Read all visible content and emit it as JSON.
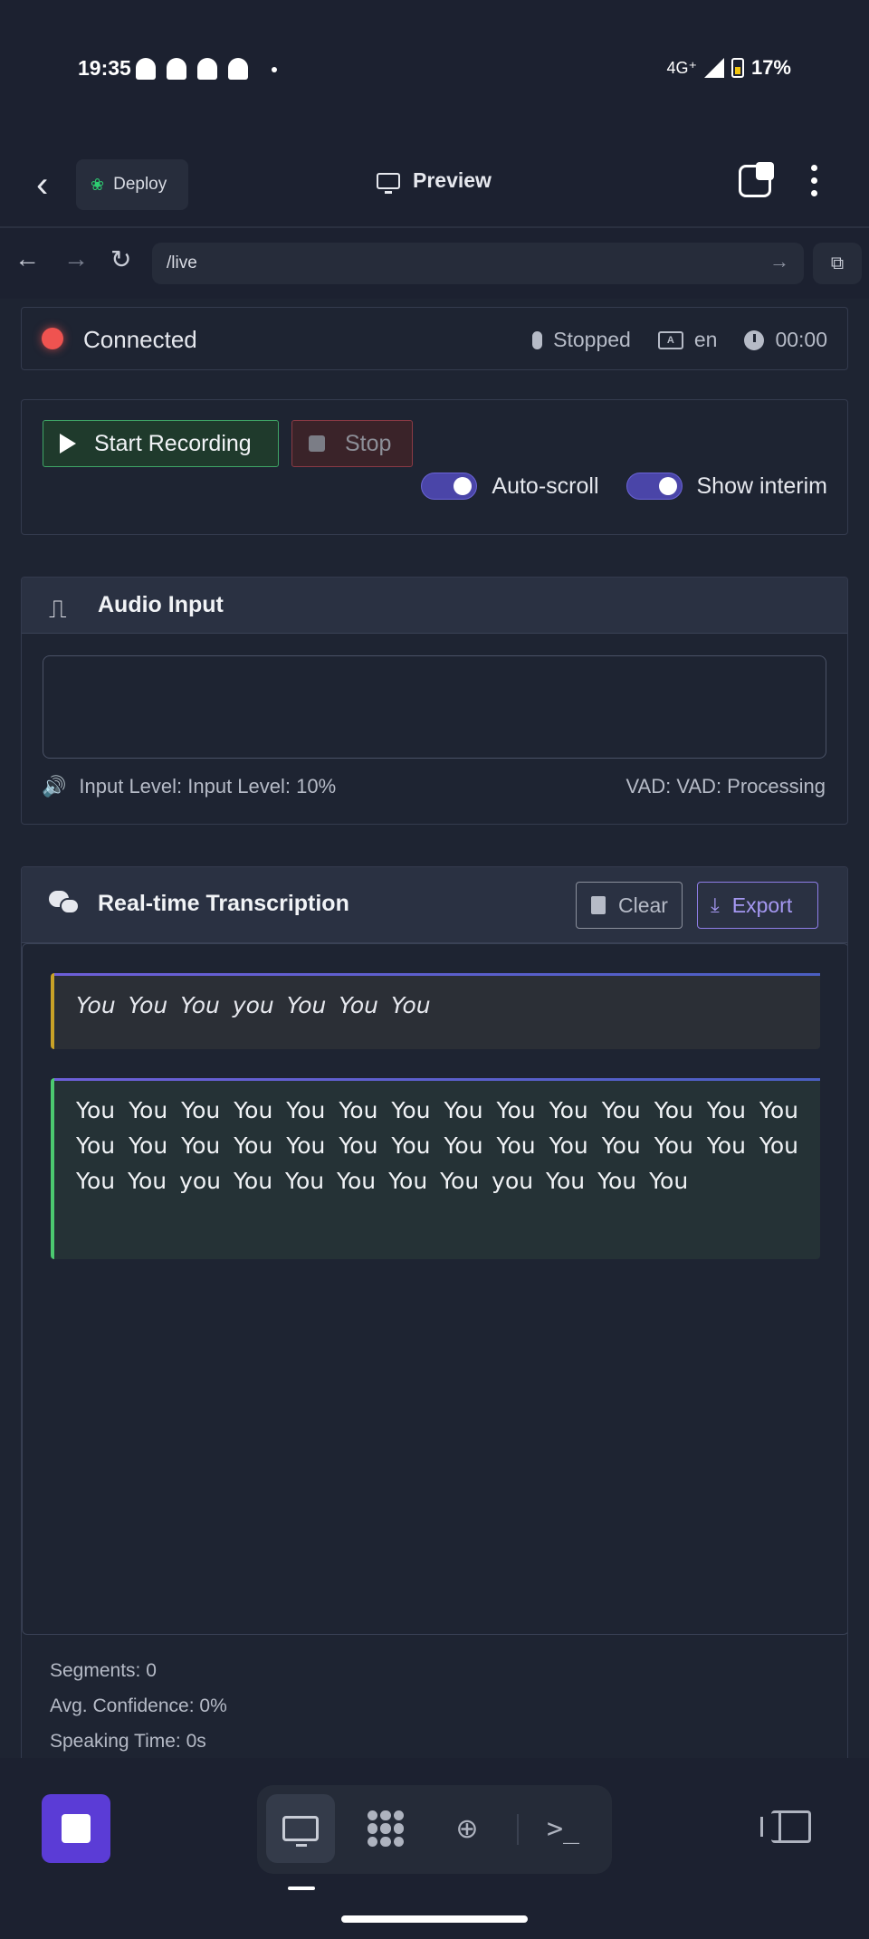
{
  "status_bar": {
    "time": "19:35",
    "network": "4G⁺",
    "battery": "17%"
  },
  "app_bar": {
    "deploy_label": "Deploy",
    "preview_label": "Preview"
  },
  "browser": {
    "url": "/live"
  },
  "status": {
    "connection": "Connected",
    "mic_state": "Stopped",
    "language": "en",
    "timer": "00:00"
  },
  "controls": {
    "start_label": "Start Recording",
    "stop_label": "Stop",
    "autoscroll_label": "Auto-scroll",
    "interim_label": "Show interim",
    "autoscroll_on": true,
    "interim_on": true
  },
  "audio_input": {
    "title": "Audio Input",
    "level_text": "Input Level: Input Level: 10%",
    "vad_text": "VAD: VAD: Processing"
  },
  "transcription": {
    "title": "Real-time Transcription",
    "clear_label": "Clear",
    "export_label": "Export",
    "interim_text": "You You You you You You You",
    "final_text": "You You You You You You You You You You You You You You You You You You You You You You You You You You You You You You you You You You You You you You You You"
  },
  "stats": {
    "segments": "Segments: 0",
    "avg_confidence": "Avg. Confidence: 0%",
    "speaking_time": "Speaking Time: 0s"
  },
  "colors": {
    "accent": "#5b3cd6",
    "connected_dot": "#ef5350",
    "start_border": "#3fa566",
    "stop_border": "#8a3a45",
    "export": "#a598f2"
  }
}
